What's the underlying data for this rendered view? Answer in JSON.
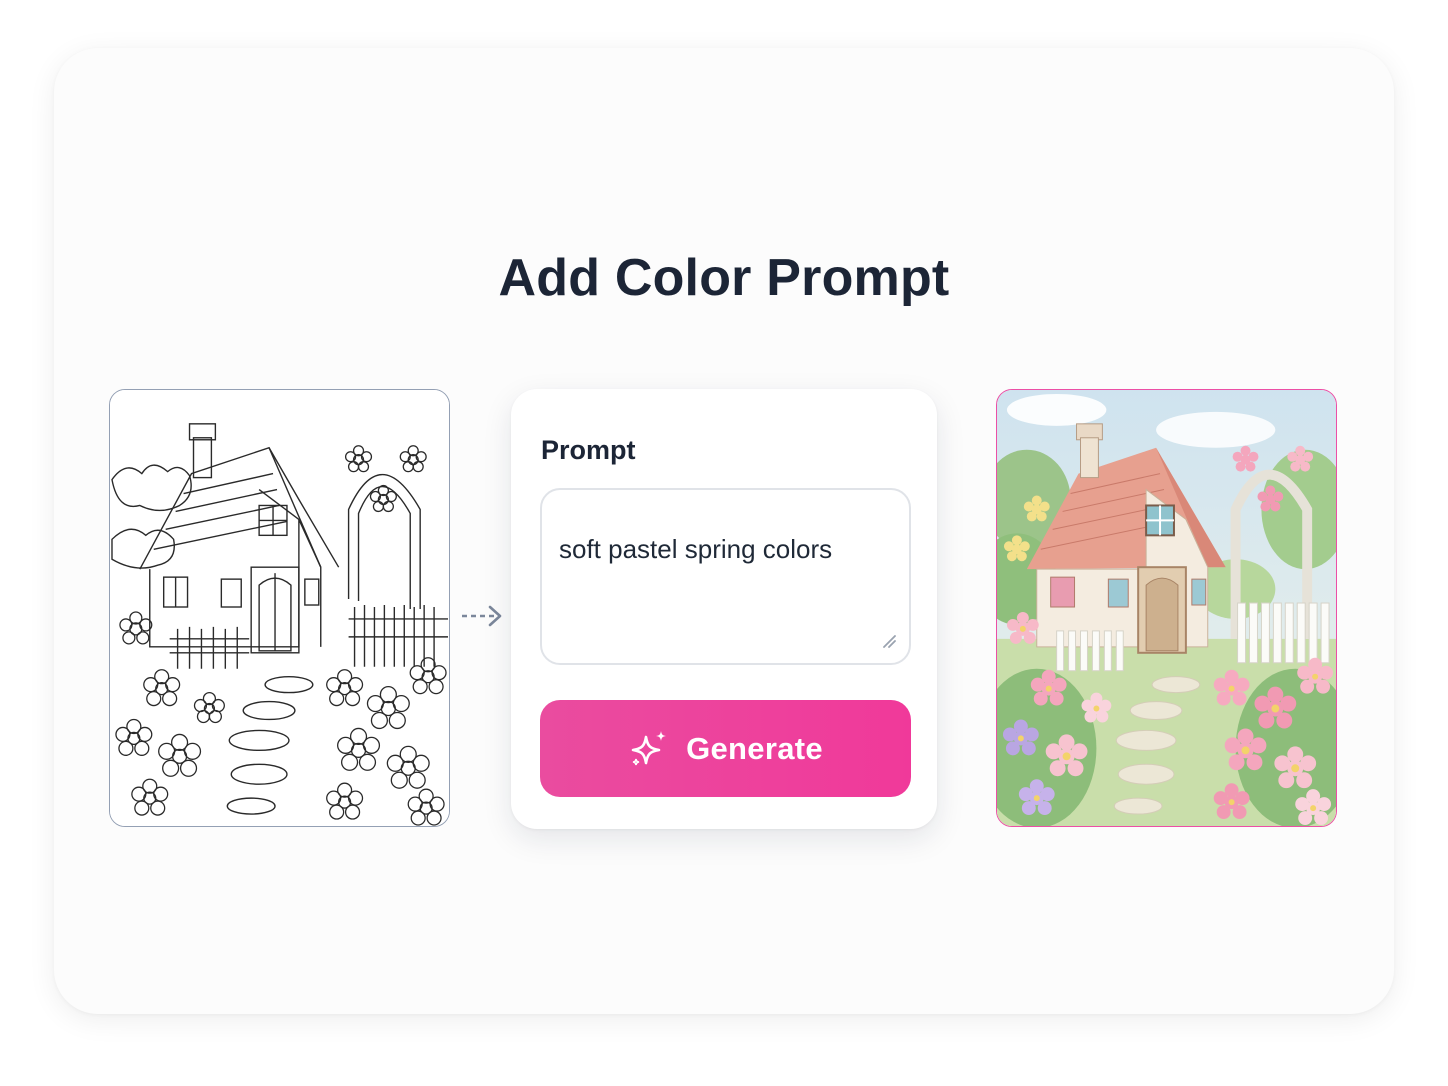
{
  "page": {
    "title": "Add Color Prompt"
  },
  "source_image": {
    "icon": "line-art-cottage",
    "description_icon": "coloring-page-outline"
  },
  "flow_arrow": {
    "icon": "dashed-arrow-right-icon"
  },
  "prompt_panel": {
    "label": "Prompt",
    "value": "soft pastel spring colors",
    "generate_label": "Generate",
    "generate_icon": "sparkle-icon"
  },
  "result_image": {
    "icon": "colored-cottage"
  },
  "colors": {
    "accent": "#ec4899",
    "title": "#1c2536",
    "source_border": "#94a0b4",
    "result_border": "#ec4fa6"
  }
}
